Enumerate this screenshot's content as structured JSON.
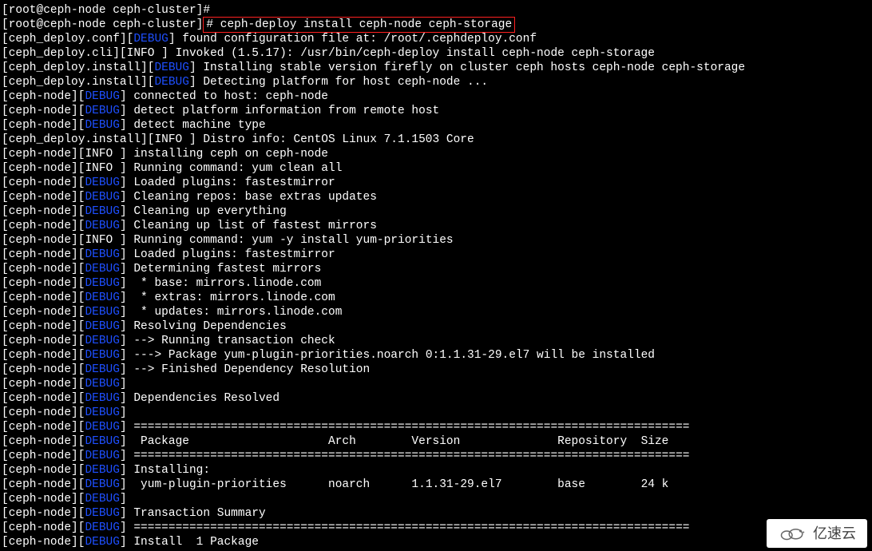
{
  "prompt": {
    "user": "root",
    "host": "ceph-node",
    "dir": "ceph-cluster",
    "text": "[root@ceph-node ceph-cluster]# "
  },
  "command": "# ceph-deploy install ceph-node ceph-storage",
  "levels": {
    "debug": "DEBUG",
    "info": "INFO "
  },
  "sources": {
    "conf": "ceph_deploy.conf",
    "cli": "ceph_deploy.cli",
    "install": "ceph_deploy.install",
    "node": "ceph-node"
  },
  "lines": [
    {
      "src": "conf",
      "lvl": "debug",
      "msg": "found configuration file at: /root/.cephdeploy.conf"
    },
    {
      "src": "cli",
      "lvl": "info",
      "msg": "Invoked (1.5.17): /usr/bin/ceph-deploy install ceph-node ceph-storage"
    },
    {
      "src": "install",
      "lvl": "debug",
      "msg": "Installing stable version firefly on cluster ceph hosts ceph-node ceph-storage"
    },
    {
      "src": "install",
      "lvl": "debug",
      "msg": "Detecting platform for host ceph-node ..."
    },
    {
      "src": "node",
      "lvl": "debug",
      "msg": "connected to host: ceph-node"
    },
    {
      "src": "node",
      "lvl": "debug",
      "msg": "detect platform information from remote host"
    },
    {
      "src": "node",
      "lvl": "debug",
      "msg": "detect machine type"
    },
    {
      "src": "install",
      "lvl": "info",
      "msg": "Distro info: CentOS Linux 7.1.1503 Core"
    },
    {
      "src": "node",
      "lvl": "info",
      "msg": "installing ceph on ceph-node"
    },
    {
      "src": "node",
      "lvl": "info",
      "msg": "Running command: yum clean all"
    },
    {
      "src": "node",
      "lvl": "debug",
      "msg": "Loaded plugins: fastestmirror"
    },
    {
      "src": "node",
      "lvl": "debug",
      "msg": "Cleaning repos: base extras updates"
    },
    {
      "src": "node",
      "lvl": "debug",
      "msg": "Cleaning up everything"
    },
    {
      "src": "node",
      "lvl": "debug",
      "msg": "Cleaning up list of fastest mirrors"
    },
    {
      "src": "node",
      "lvl": "info",
      "msg": "Running command: yum -y install yum-priorities"
    },
    {
      "src": "node",
      "lvl": "debug",
      "msg": "Loaded plugins: fastestmirror"
    },
    {
      "src": "node",
      "lvl": "debug",
      "msg": "Determining fastest mirrors"
    },
    {
      "src": "node",
      "lvl": "debug",
      "msg": " * base: mirrors.linode.com"
    },
    {
      "src": "node",
      "lvl": "debug",
      "msg": " * extras: mirrors.linode.com"
    },
    {
      "src": "node",
      "lvl": "debug",
      "msg": " * updates: mirrors.linode.com"
    },
    {
      "src": "node",
      "lvl": "debug",
      "msg": "Resolving Dependencies"
    },
    {
      "src": "node",
      "lvl": "debug",
      "msg": "--> Running transaction check"
    },
    {
      "src": "node",
      "lvl": "debug",
      "msg": "---> Package yum-plugin-priorities.noarch 0:1.1.31-29.el7 will be installed"
    },
    {
      "src": "node",
      "lvl": "debug",
      "msg": "--> Finished Dependency Resolution"
    },
    {
      "src": "node",
      "lvl": "debug",
      "msg": ""
    },
    {
      "src": "node",
      "lvl": "debug",
      "msg": "Dependencies Resolved"
    },
    {
      "src": "node",
      "lvl": "debug",
      "msg": ""
    },
    {
      "src": "node",
      "lvl": "debug",
      "msg": "================================================================================"
    },
    {
      "src": "node",
      "lvl": "debug",
      "msg": " Package                    Arch        Version              Repository  Size"
    },
    {
      "src": "node",
      "lvl": "debug",
      "msg": "================================================================================"
    },
    {
      "src": "node",
      "lvl": "debug",
      "msg": "Installing:"
    },
    {
      "src": "node",
      "lvl": "debug",
      "msg": " yum-plugin-priorities      noarch      1.1.31-29.el7        base        24 k"
    },
    {
      "src": "node",
      "lvl": "debug",
      "msg": ""
    },
    {
      "src": "node",
      "lvl": "debug",
      "msg": "Transaction Summary"
    },
    {
      "src": "node",
      "lvl": "debug",
      "msg": "================================================================================"
    },
    {
      "src": "node",
      "lvl": "debug",
      "msg": "Install  1 Package"
    }
  ],
  "watermark": "亿速云"
}
